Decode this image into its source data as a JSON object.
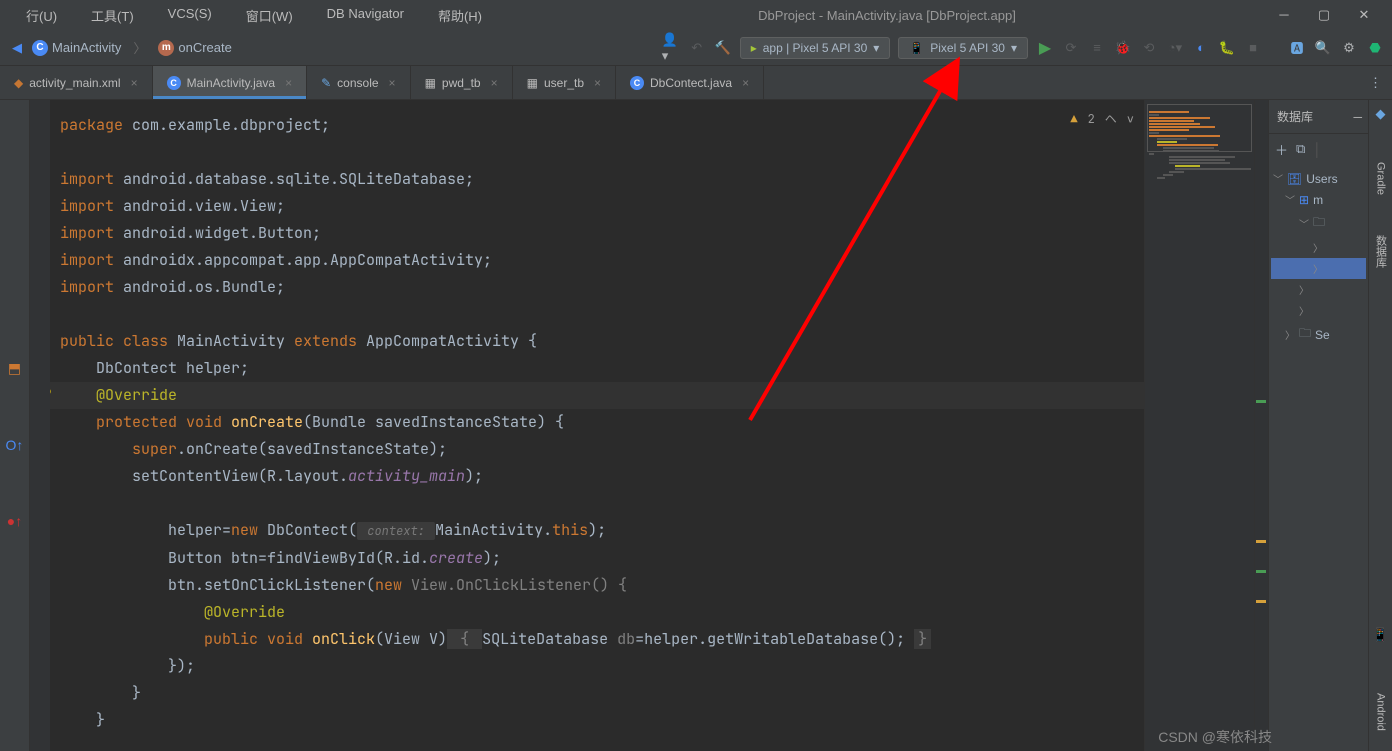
{
  "title": "DbProject - MainActivity.java [DbProject.app]",
  "menu": {
    "items": [
      "行(U)",
      "工具(T)",
      "VCS(S)",
      "窗口(W)",
      "DB Navigator",
      "帮助(H)"
    ]
  },
  "breadcrumb": {
    "item1": "MainActivity",
    "item2": "onCreate"
  },
  "toolbar": {
    "config1": "app | Pixel 5 API 30",
    "config2": "Pixel 5 API 30"
  },
  "tabs": [
    {
      "label": "activity_main.xml",
      "icon": "xml",
      "active": false
    },
    {
      "label": "MainActivity.java",
      "icon": "class",
      "active": true
    },
    {
      "label": "console",
      "icon": "console",
      "active": false
    },
    {
      "label": "pwd_tb",
      "icon": "table",
      "active": false
    },
    {
      "label": "user_tb",
      "icon": "table",
      "active": false
    },
    {
      "label": "DbContect.java",
      "icon": "class",
      "active": false
    }
  ],
  "editor": {
    "warning_count": "2",
    "lines": {
      "l1_kw": "package ",
      "l1_rest": "com.example.dbproject;",
      "l3_kw": "import ",
      "l3_rest": "android.database.sqlite.SQLiteDatabase;",
      "l4_rest": "android.view.View;",
      "l5_rest": "android.widget.Button;",
      "l6_rest": "androidx.appcompat.app.AppCompatActivity;",
      "l7_rest": "android.os.Bundle;",
      "l9_public": "public class ",
      "l9_name": "MainActivity ",
      "l9_extends": "extends ",
      "l9_super": "AppCompatActivity {",
      "l10": "    DbContect helper;",
      "l11_ann": "@Override",
      "l12_prot": "protected void ",
      "l12_method": "onCreate",
      "l12_params": "(Bundle savedInstanceState) {",
      "l13_super": "super",
      "l13_rest": ".onCreate(savedInstanceState);",
      "l14_1": "setContentView(R.layout.",
      "l14_2": "activity_main",
      "l14_3": ");",
      "l16_1": "helper=",
      "l16_new": "new ",
      "l16_2": "DbContect(",
      "l16_hint": " context: ",
      "l16_3": "MainActivity.",
      "l16_this": "this",
      "l16_4": ");",
      "l17_1": "Button btn=findViewById(R.id.",
      "l17_2": "create",
      "l17_3": ");",
      "l18_1": "btn.setOnClickListener(",
      "l18_new": "new ",
      "l18_2": "View.OnClickListener() {",
      "l19_ann": "@Override",
      "l20_pub": "public void ",
      "l20_method": "onClick",
      "l20_param": "(View V)",
      "l20_br1": " { ",
      "l20_body1": "SQLiteDatabase ",
      "l20_var": "db",
      "l20_eq": "=helper.getWritableDatabase(); ",
      "l20_br2": "}",
      "l21": "});",
      "l22": "}",
      "l23": "}"
    }
  },
  "rightPanel": {
    "title": "数据库",
    "tree": {
      "root": "Users",
      "child1": "m",
      "leaf": "Se"
    }
  },
  "sideStrip": {
    "label1": "Gradle",
    "label2": "数据库",
    "label3": "Android"
  },
  "watermark": "CSDN @寒依科技"
}
